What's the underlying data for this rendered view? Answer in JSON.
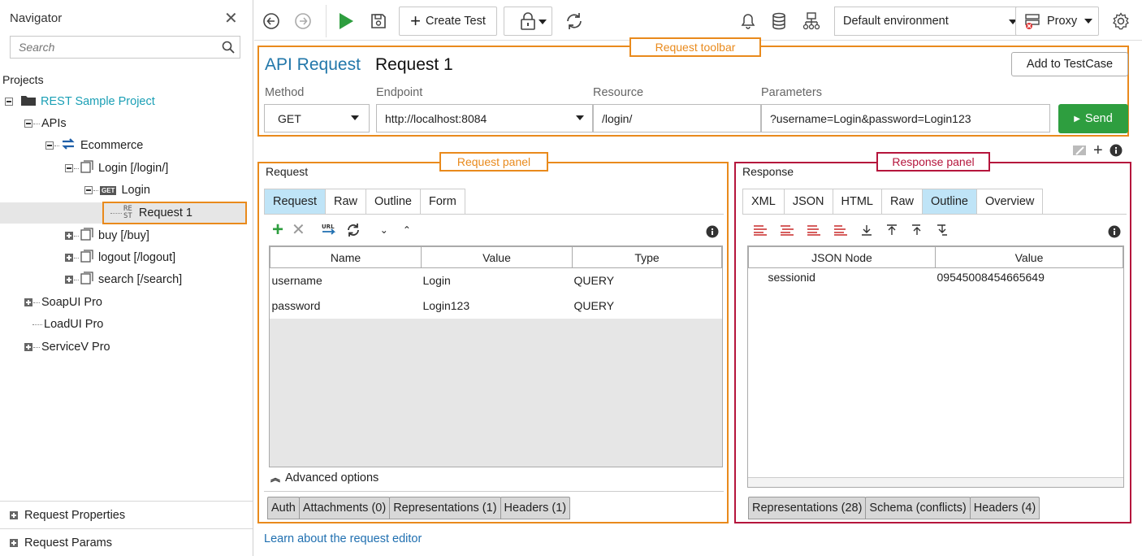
{
  "navigator": {
    "title": "Navigator",
    "search_placeholder": "Search",
    "projects_label": "Projects",
    "tree": {
      "project": "REST Sample Project",
      "apis": "APIs",
      "ecommerce": "Ecommerce",
      "login_resource": "Login [/login/]",
      "login_method_badge": "GET",
      "login_method": "Login",
      "request_badge_top": "RE",
      "request_badge_bottom": "ST",
      "request": "Request 1",
      "buy": "buy [/buy]",
      "logout": "logout [/logout]",
      "search": "search [/search]",
      "soapui": "SoapUI Pro",
      "loadui": "LoadUI Pro",
      "servicev": "ServiceV Pro"
    },
    "bottom": {
      "request_properties": "Request Properties",
      "request_params": "Request Params"
    }
  },
  "toolbar": {
    "create_test": "Create Test",
    "environment": "Default environment",
    "proxy": "Proxy"
  },
  "callouts": {
    "request_toolbar": "Request toolbar",
    "request_panel": "Request panel",
    "response_panel": "Response panel"
  },
  "request_toolbar": {
    "api_type": "API Request",
    "request_name": "Request 1",
    "add_to_testcase": "Add to TestCase",
    "method_label": "Method",
    "method_value": "GET",
    "endpoint_label": "Endpoint",
    "endpoint_value": "http://localhost:8084",
    "resource_label": "Resource",
    "resource_value": "/login/",
    "parameters_label": "Parameters",
    "parameters_value": "?username=Login&password=Login123",
    "send": "Send"
  },
  "request_panel": {
    "title": "Request",
    "tabs": [
      "Request",
      "Raw",
      "Outline",
      "Form"
    ],
    "active_tab": "Request",
    "columns": [
      "Name",
      "Value",
      "Type"
    ],
    "rows": [
      {
        "name": "username",
        "value": "Login",
        "type": "QUERY"
      },
      {
        "name": "password",
        "value": "Login123",
        "type": "QUERY"
      }
    ],
    "advanced_options": "Advanced options",
    "bottom_tabs": [
      "Auth",
      "Attachments (0)",
      "Representations (1)",
      "Headers (1)"
    ]
  },
  "response_panel": {
    "title": "Response",
    "tabs": [
      "XML",
      "JSON",
      "HTML",
      "Raw",
      "Outline",
      "Overview"
    ],
    "active_tab": "Outline",
    "columns": [
      "JSON Node",
      "Value"
    ],
    "rows": [
      {
        "node": "sessionid",
        "value": "09545008454665649"
      }
    ],
    "bottom_tabs": [
      "Representations (28)",
      "Schema (conflicts)",
      "Headers (4)"
    ]
  },
  "footer": {
    "learn_link": "Learn about the request editor"
  },
  "colors": {
    "accent_orange": "#e98a1c",
    "accent_red": "#b5153c",
    "send_green": "#2e9e3f",
    "link_blue": "#1f6fb0",
    "project_teal": "#1a9fb5",
    "active_tab": "#bfe4f7"
  }
}
